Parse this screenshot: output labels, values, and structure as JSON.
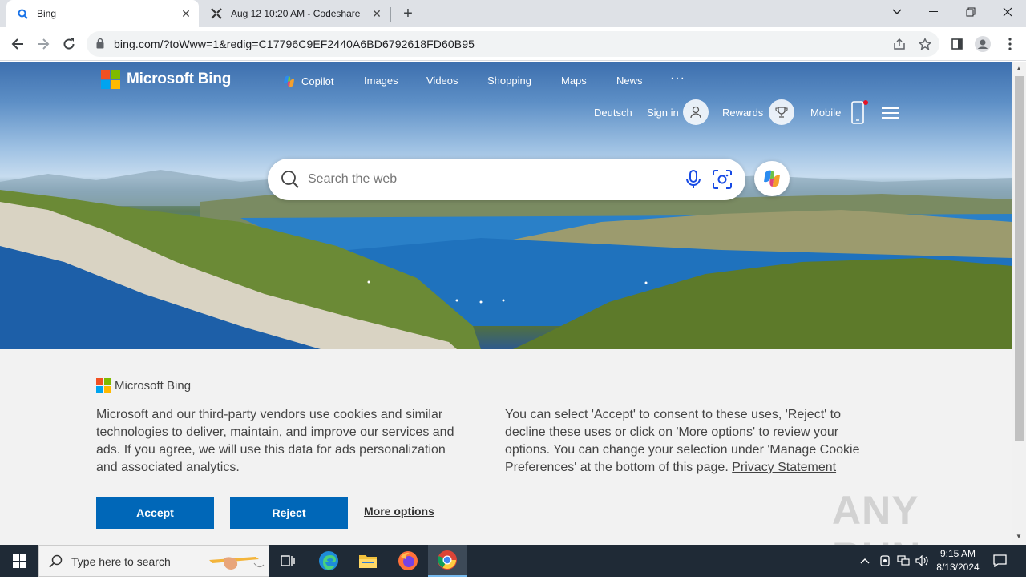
{
  "browser": {
    "tabs": [
      {
        "title": "Bing",
        "active": true
      },
      {
        "title": "Aug 12 10:20 AM - Codeshare",
        "active": false
      }
    ],
    "url": "bing.com/?toWww=1&redig=C17796C9EF2440A6BD6792618FD60B95"
  },
  "bing": {
    "logo_text": "Microsoft Bing",
    "nav": [
      "Copilot",
      "Images",
      "Videos",
      "Shopping",
      "Maps",
      "News",
      "···"
    ],
    "header": {
      "language": "Deutsch",
      "sign_in": "Sign in",
      "rewards": "Rewards",
      "mobile": "Mobile"
    },
    "search": {
      "placeholder": "Search the web"
    }
  },
  "cookie": {
    "logo_text": "Microsoft Bing",
    "text_left": "Microsoft and our third-party vendors use cookies and similar technologies to deliver, maintain, and improve our services and ads. If you agree, we will use this data for ads personalization and associated analytics.",
    "text_right": "You can select 'Accept' to consent to these uses, 'Reject' to decline these uses or click on 'More options' to review your options. You can change your selection under 'Manage Cookie Preferences' at the bottom of this page.",
    "privacy_link": "Privacy Statement",
    "accept": "Accept",
    "reject": "Reject",
    "more_options": "More options"
  },
  "watermark": "ANY RUN",
  "taskbar": {
    "search_placeholder": "Type here to search",
    "time": "9:15 AM",
    "date": "8/13/2024"
  },
  "colors": {
    "accent": "#0067b8",
    "cookie_bg": "#f2f2f2",
    "taskbar_bg": "#1f2a36"
  }
}
